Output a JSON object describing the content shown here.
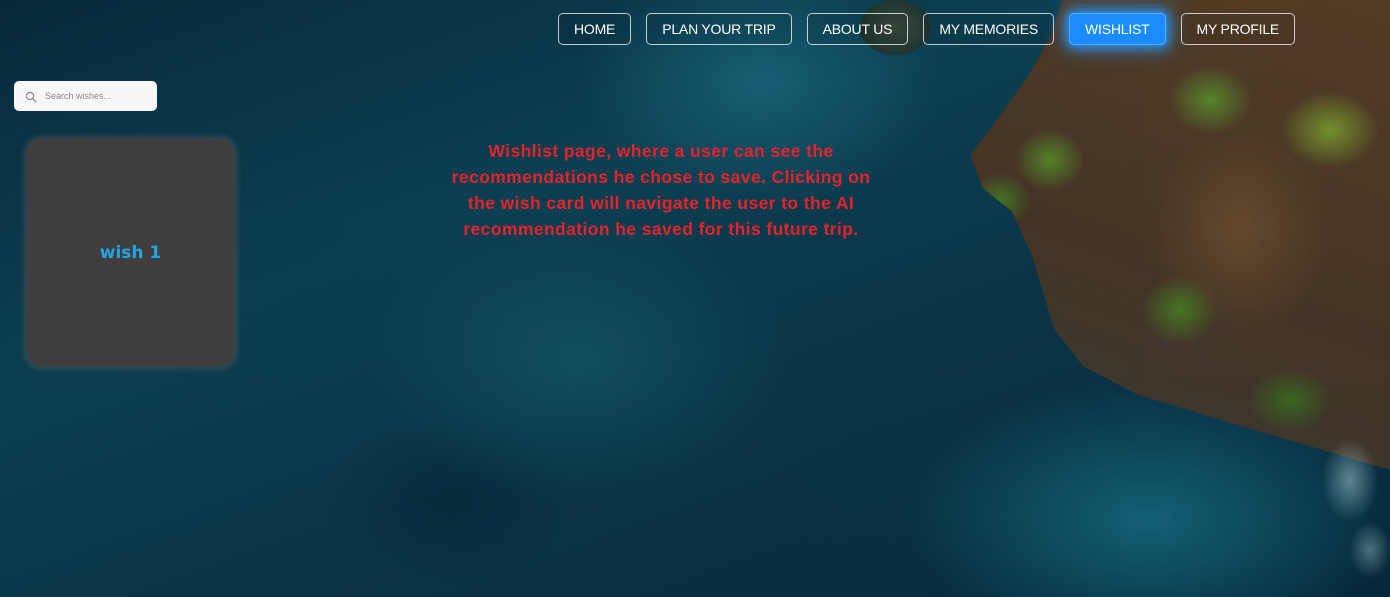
{
  "nav": {
    "items": [
      {
        "label": "HOME",
        "active": false
      },
      {
        "label": "PLAN YOUR TRIP",
        "active": false
      },
      {
        "label": "ABOUT US",
        "active": false
      },
      {
        "label": "MY MEMORIES",
        "active": false
      },
      {
        "label": "WISHLIST",
        "active": true
      },
      {
        "label": "MY PROFILE",
        "active": false
      }
    ]
  },
  "search": {
    "placeholder": "Search wishes...",
    "value": "",
    "icon": "search-icon"
  },
  "wishes": [
    {
      "title": "wish 1"
    }
  ],
  "annotation": {
    "text": "Wishlist page, where a user can see the recommendations he chose to save. Clicking on the wish card will navigate the user to the AI recommendation he saved for this future trip."
  },
  "colors": {
    "active_nav": "#1a8cff",
    "wish_title": "#22a6e8",
    "card_bg": "#3f3d3e",
    "annotation": "#e4232b"
  }
}
